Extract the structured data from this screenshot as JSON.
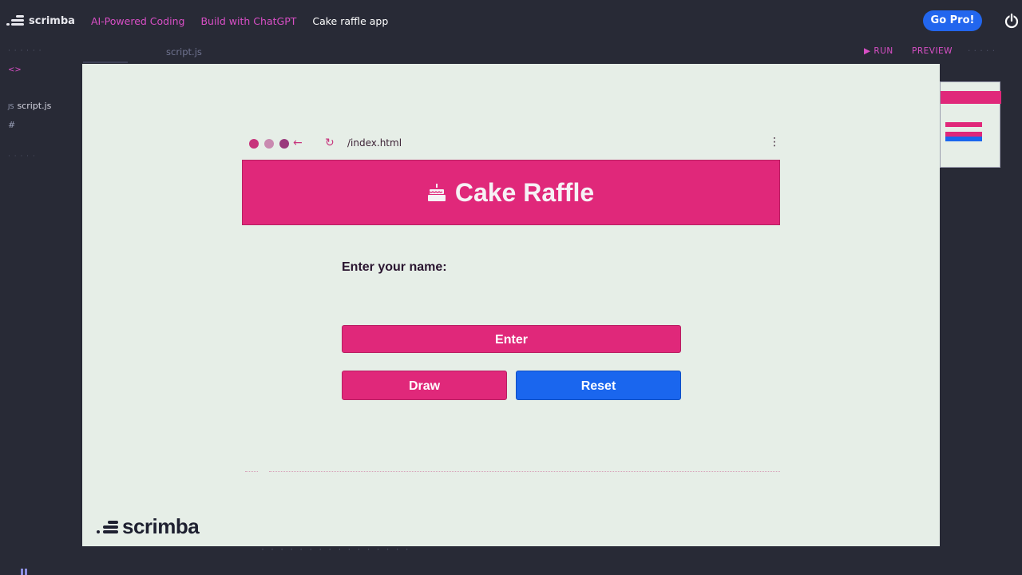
{
  "topbar": {
    "brand": "scrimba",
    "breadcrumbs": [
      "AI-Powered Coding",
      "Build with ChatGPT",
      "Cake raffle app"
    ],
    "go_pro": "Go Pro!"
  },
  "editor": {
    "tab": "script.js",
    "run": "RUN",
    "preview": "PREVIEW",
    "files": [
      {
        "ext": "JS",
        "name": "script.js"
      },
      {
        "ext": "",
        "name": "#"
      }
    ],
    "html_icon": "<>"
  },
  "preview": {
    "url": "/index.html",
    "app": {
      "title": "Cake Raffle",
      "name_label": "Enter your name:",
      "enter_button": "Enter",
      "draw_button": "Draw",
      "reset_button": "Reset"
    },
    "watermark": "scrimba"
  },
  "colors": {
    "background": "#282a36",
    "accent_pink": "#e0287a",
    "accent_blue": "#1a66ee",
    "preview_bg": "#e6eee7",
    "breadcrumb": "#d94fc6"
  }
}
